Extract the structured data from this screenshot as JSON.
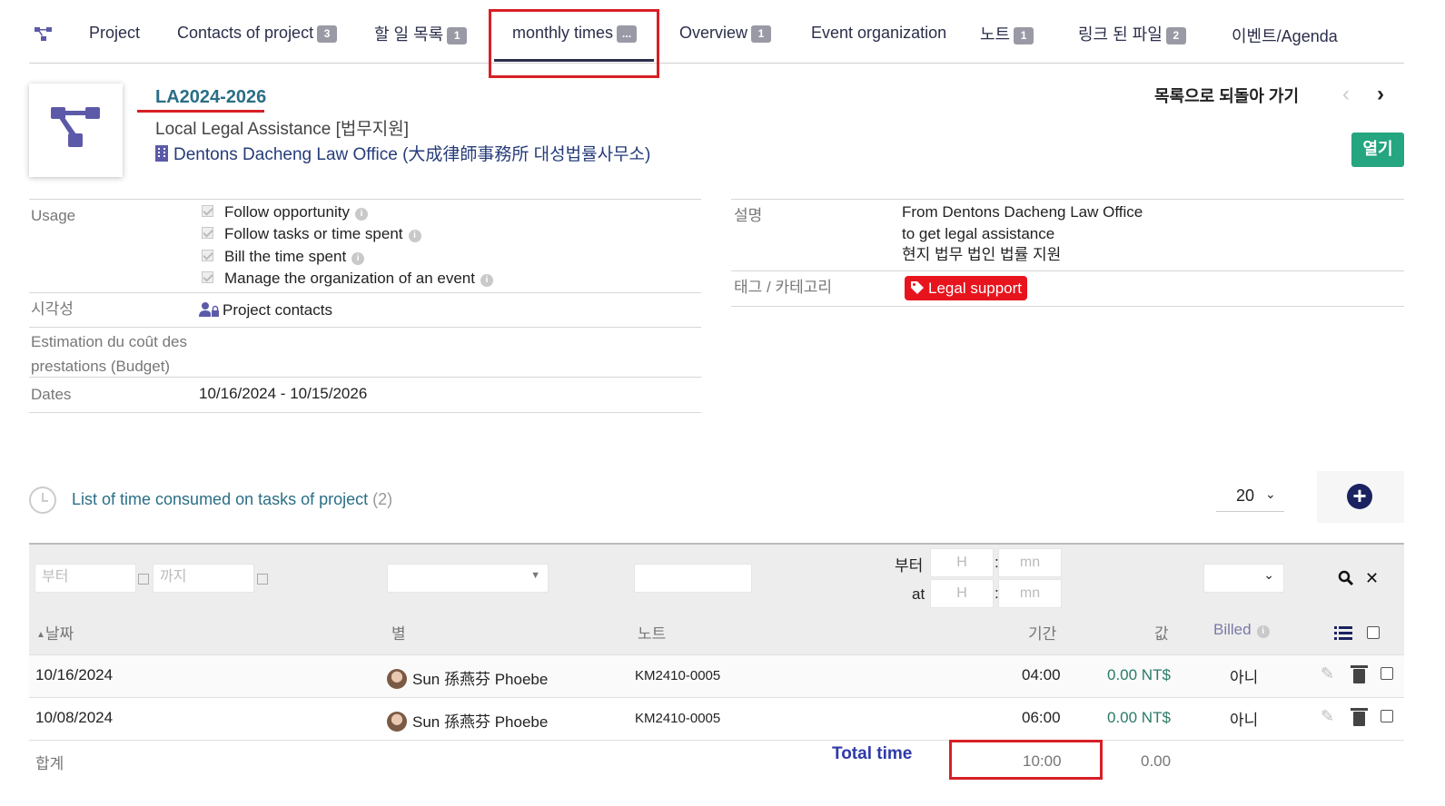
{
  "tabs": [
    {
      "label": "Project",
      "badge": ""
    },
    {
      "label": "Contacts of project",
      "badge": "3"
    },
    {
      "label": "할 일 목록",
      "badge": "1"
    },
    {
      "label": "monthly times",
      "badge": "..."
    },
    {
      "label": "Overview",
      "badge": "1"
    },
    {
      "label": "Event organization",
      "badge": ""
    },
    {
      "label": "노트",
      "badge": "1"
    },
    {
      "label": "링크 된 파일",
      "badge": "2"
    },
    {
      "label": "이벤트/Agenda",
      "badge": ""
    }
  ],
  "header": {
    "ref": "LA2024-2026",
    "title": "Local Legal Assistance [법무지원]",
    "thirdparty": "Dentons Dacheng Law Office (大成律師事務所 대성법률사무소)",
    "back_to_list": "목록으로 되돌아 가기",
    "prev": "‹",
    "next": "›",
    "open_status": "열기"
  },
  "fields": {
    "usage_label": "Usage",
    "usage_options": [
      "Follow opportunity",
      "Follow tasks or time spent",
      "Bill the time spent",
      "Manage the organization of an event"
    ],
    "visibility_label": "시각성",
    "visibility_value": "Project contacts",
    "budget_label_line1": "Estimation du coût des",
    "budget_label_line2": "prestations (Budget)",
    "dates_label": "Dates",
    "dates_value": "10/16/2024 - 10/15/2026",
    "description_label": "설명",
    "description_lines": [
      "From Dentons Dacheng Law Office",
      "to get legal assistance",
      "현지 법무 법인 법률 지원"
    ],
    "tags_label": "태그 / 카테고리",
    "tag": "Legal support"
  },
  "list": {
    "title": "List of time consumed on tasks of project",
    "count": "(2)",
    "page_size": "20",
    "filters": {
      "from_placeholder": "부터",
      "to_placeholder": "까지",
      "duration_from_label": "부터",
      "duration_at_label": "at",
      "hour_placeholder": "H",
      "minute_placeholder": "mn",
      "sep": ":"
    },
    "columns": {
      "date": "날짜",
      "user": "별",
      "note": "노트",
      "duration": "기간",
      "value": "값",
      "billed": "Billed"
    },
    "rows": [
      {
        "date": "10/16/2024",
        "user": "Sun 孫燕芬 Phoebe",
        "note": "KM2410-0005",
        "duration": "04:00",
        "value": "0.00 NT$",
        "billed": "아니"
      },
      {
        "date": "10/08/2024",
        "user": "Sun 孫燕芬 Phoebe",
        "note": "KM2410-0005",
        "duration": "06:00",
        "value": "0.00 NT$",
        "billed": "아니"
      }
    ],
    "total_label": "합계",
    "total_time_label": "Total time",
    "total_duration": "10:00",
    "total_value": "0.00"
  },
  "colors": {
    "accent": "#2a6e86",
    "highlight": "#d81f26",
    "tag": "#e8141d",
    "status_open": "#25a580",
    "add_button": "#1a2360"
  }
}
